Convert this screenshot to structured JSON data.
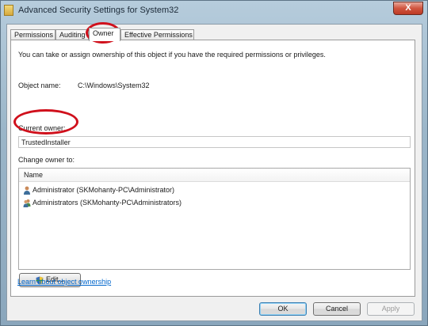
{
  "window": {
    "title": "Advanced Security Settings for System32",
    "close_glyph": "X"
  },
  "tabs": [
    {
      "label": "Permissions"
    },
    {
      "label": "Auditing"
    },
    {
      "label": "Owner"
    },
    {
      "label": "Effective Permissions"
    }
  ],
  "owner_tab": {
    "intro": "You can take or assign ownership of this object if you have the required permissions or privileges.",
    "object_name_label": "Object name:",
    "object_name_value": "C:\\Windows\\System32",
    "current_owner_label": "Current owner:",
    "current_owner_value": "TrustedInstaller",
    "change_owner_label": "Change owner to:",
    "list_header": "Name",
    "owners": [
      {
        "label": "Administrator (SKMohanty-PC\\Administrator)",
        "icon": "user-icon"
      },
      {
        "label": "Administrators (SKMohanty-PC\\Administrators)",
        "icon": "group-icon"
      }
    ],
    "edit_button": "Edit...",
    "learn_link": "Learn about object ownership"
  },
  "footer": {
    "ok": "OK",
    "cancel": "Cancel",
    "apply": "Apply"
  },
  "annotations": {
    "color": "#d0101c"
  }
}
